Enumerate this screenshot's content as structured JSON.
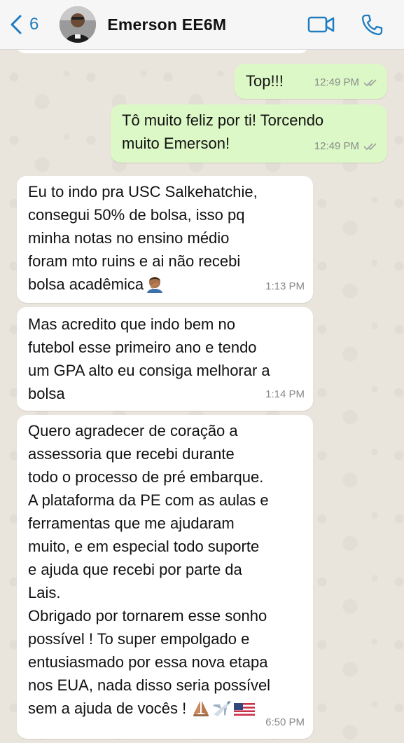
{
  "header": {
    "back_count": "6",
    "contact_name": "Emerson EE6M"
  },
  "messages": [
    {
      "direction": "out",
      "text": "Top!!!",
      "time": "12:49 PM",
      "status": "read"
    },
    {
      "direction": "out",
      "text": "Tô muito feliz por ti! Torcendo\nmuito Emerson!",
      "time": "12:49 PM",
      "status": "read"
    },
    {
      "direction": "in",
      "text": "Eu to indo pra USC Salkehatchie,\nconsegui 50% de bolsa, isso pq\nminha notas no ensino médio\nforam mto ruins e ai não recebi\nbolsa acadêmica",
      "emoji": "man-facepalming",
      "time": "1:13 PM"
    },
    {
      "direction": "in",
      "text": "Mas acredito que indo bem no\nfutebol esse primeiro ano e tendo\num GPA alto eu consiga melhorar a\nbolsa",
      "time": "1:14 PM"
    },
    {
      "direction": "in",
      "text": "Quero agradecer de coração a\nassessoria que recebi durante\ntodo o processo de pré embarque.\nA plataforma da PE com as aulas e\nferramentas que me ajudaram\nmuito, e em especial todo suporte\ne ajuda que recebi por parte da\nLais.\nObrigado por tornarem esse sonho\npossível ! To super empolgado e\nentusiasmado por essa nova etapa\nnos EUA, nada disso seria possível\nsem a ajuda de vocês !",
      "emoji": "folded-hands airplane us-flag",
      "time": "6:50 PM"
    }
  ],
  "colors": {
    "outgoing_bubble": "#dcf8c6",
    "incoming_bubble": "#ffffff",
    "accent": "#1f7cc0",
    "read_ticks": "#a0a0a0"
  }
}
